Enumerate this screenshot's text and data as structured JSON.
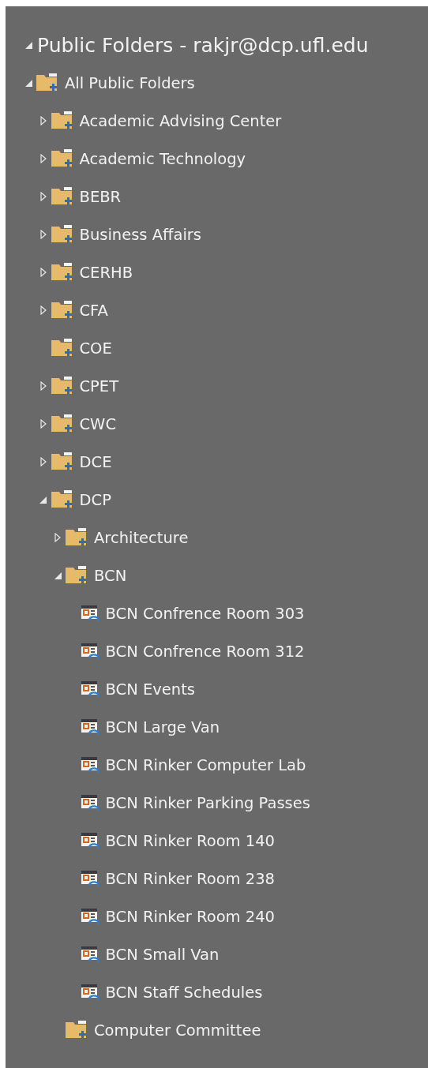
{
  "header": {
    "title": "Public Folders - rakjr@dcp.ufl.edu",
    "expanded": true
  },
  "tree": [
    {
      "label": "All Public Folders",
      "kind": "folder",
      "expanded": true,
      "children": [
        {
          "label": "Academic Advising Center",
          "kind": "folder",
          "expanded": false
        },
        {
          "label": "Academic Technology",
          "kind": "folder",
          "expanded": false
        },
        {
          "label": "BEBR",
          "kind": "folder",
          "expanded": false
        },
        {
          "label": "Business Affairs",
          "kind": "folder",
          "expanded": false
        },
        {
          "label": "CERHB",
          "kind": "folder",
          "expanded": false
        },
        {
          "label": "CFA",
          "kind": "folder",
          "expanded": false
        },
        {
          "label": "COE",
          "kind": "folder"
        },
        {
          "label": "CPET",
          "kind": "folder",
          "expanded": false
        },
        {
          "label": "CWC",
          "kind": "folder",
          "expanded": false
        },
        {
          "label": "DCE",
          "kind": "folder",
          "expanded": false
        },
        {
          "label": "DCP",
          "kind": "folder",
          "expanded": true,
          "children": [
            {
              "label": "Architecture",
              "kind": "folder",
              "expanded": false
            },
            {
              "label": "BCN",
              "kind": "folder",
              "expanded": true,
              "children": [
                {
                  "label": "BCN Confrence Room 303",
                  "kind": "calendar"
                },
                {
                  "label": "BCN Confrence Room 312",
                  "kind": "calendar"
                },
                {
                  "label": "BCN Events",
                  "kind": "calendar"
                },
                {
                  "label": "BCN Large Van",
                  "kind": "calendar"
                },
                {
                  "label": "BCN Rinker Computer Lab",
                  "kind": "calendar"
                },
                {
                  "label": "BCN Rinker Parking Passes",
                  "kind": "calendar"
                },
                {
                  "label": "BCN Rinker Room 140",
                  "kind": "calendar"
                },
                {
                  "label": "BCN Rinker Room 238",
                  "kind": "calendar"
                },
                {
                  "label": "BCN Rinker Room 240",
                  "kind": "calendar"
                },
                {
                  "label": "BCN Small Van",
                  "kind": "calendar"
                },
                {
                  "label": "BCN Staff Schedules",
                  "kind": "calendar"
                }
              ]
            },
            {
              "label": "Computer Committee",
              "kind": "folder"
            }
          ]
        }
      ]
    }
  ]
}
